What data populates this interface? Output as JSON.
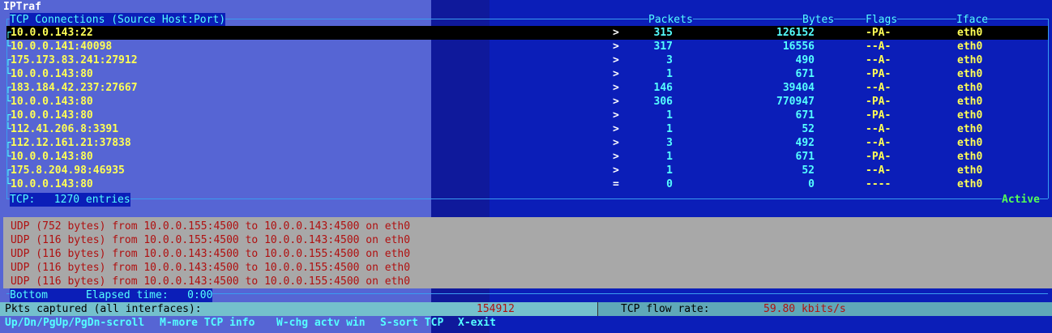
{
  "app": {
    "title": "IPTraf"
  },
  "tcp": {
    "header": {
      "connections": "TCP Connections (Source Host:Port)",
      "packets": "Packets",
      "bytes": "Bytes",
      "flags": "Flags",
      "iface": "Iface"
    },
    "rows": [
      {
        "host": "10.0.0.143:22",
        "dir": ">",
        "packets": "315",
        "bytes": "126152",
        "flags": "-PA-",
        "iface": "eth0",
        "bracket": "┌"
      },
      {
        "host": "10.0.0.141:40098",
        "dir": ">",
        "packets": "317",
        "bytes": "16556",
        "flags": "--A-",
        "iface": "eth0",
        "bracket": "└"
      },
      {
        "host": "175.173.83.241:27912",
        "dir": ">",
        "packets": "3",
        "bytes": "490",
        "flags": "--A-",
        "iface": "eth0",
        "bracket": "┌"
      },
      {
        "host": "10.0.0.143:80",
        "dir": ">",
        "packets": "1",
        "bytes": "671",
        "flags": "-PA-",
        "iface": "eth0",
        "bracket": "└"
      },
      {
        "host": "183.184.42.237:27667",
        "dir": ">",
        "packets": "146",
        "bytes": "39404",
        "flags": "--A-",
        "iface": "eth0",
        "bracket": "┌"
      },
      {
        "host": "10.0.0.143:80",
        "dir": ">",
        "packets": "306",
        "bytes": "770947",
        "flags": "-PA-",
        "iface": "eth0",
        "bracket": "└"
      },
      {
        "host": "10.0.0.143:80",
        "dir": ">",
        "packets": "1",
        "bytes": "671",
        "flags": "-PA-",
        "iface": "eth0",
        "bracket": "┌"
      },
      {
        "host": "112.41.206.8:3391",
        "dir": ">",
        "packets": "1",
        "bytes": "52",
        "flags": "--A-",
        "iface": "eth0",
        "bracket": "└"
      },
      {
        "host": "112.12.161.21:37838",
        "dir": ">",
        "packets": "3",
        "bytes": "492",
        "flags": "--A-",
        "iface": "eth0",
        "bracket": "┌"
      },
      {
        "host": "10.0.0.143:80",
        "dir": ">",
        "packets": "1",
        "bytes": "671",
        "flags": "-PA-",
        "iface": "eth0",
        "bracket": "└"
      },
      {
        "host": "175.8.204.98:46935",
        "dir": ">",
        "packets": "1",
        "bytes": "52",
        "flags": "--A-",
        "iface": "eth0",
        "bracket": "┌"
      },
      {
        "host": "10.0.0.143:80",
        "dir": "=",
        "packets": "0",
        "bytes": "0",
        "flags": "----",
        "iface": "eth0",
        "bracket": "└"
      }
    ],
    "footer": {
      "entries": "TCP:   1270 entries",
      "status": "Active"
    }
  },
  "lower": {
    "messages": [
      "UDP (752 bytes) from 10.0.0.155:4500 to 10.0.0.143:4500 on eth0",
      "UDP (116 bytes) from 10.0.0.155:4500 to 10.0.0.143:4500 on eth0",
      "UDP (116 bytes) from 10.0.0.143:4500 to 10.0.0.155:4500 on eth0",
      "UDP (116 bytes) from 10.0.0.143:4500 to 10.0.0.155:4500 on eth0",
      "UDP (116 bytes) from 10.0.0.143:4500 to 10.0.0.155:4500 on eth0"
    ],
    "footer": "Bottom      Elapsed time:   0:00"
  },
  "status": {
    "pkts_label": "Pkts captured (all interfaces):",
    "pkts_value": "154912",
    "rate_label": "TCP flow rate:",
    "rate_value": "59.80 kbits/s"
  },
  "keys": [
    {
      "key": "Up/Dn/PgUp/PgDn",
      "desc": "-scroll"
    },
    {
      "key": "M",
      "desc": "-more TCP info"
    },
    {
      "key": "W",
      "desc": "-chg actv win"
    },
    {
      "key": "S",
      "desc": "-sort TCP"
    },
    {
      "key": "X",
      "desc": "-exit"
    }
  ]
}
